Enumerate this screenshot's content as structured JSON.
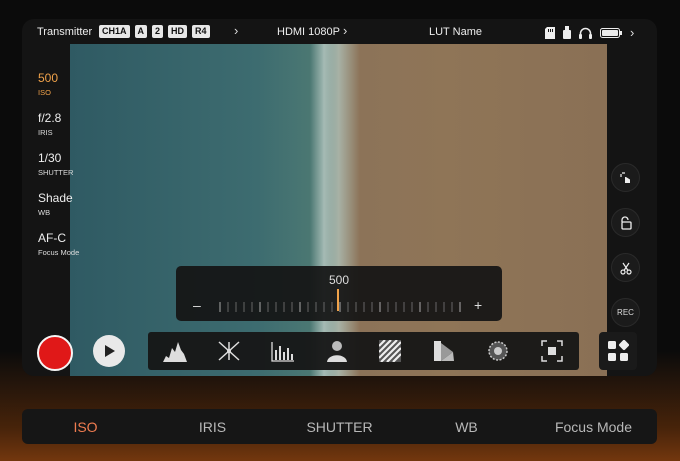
{
  "accent_color": "#f0a24a",
  "topbar": {
    "transmitter_label": "Transmitter",
    "badges": [
      "CH1A",
      "A",
      "2",
      "HD",
      "R4"
    ],
    "signal": "HDMI 1080P",
    "lut": "LUT Name"
  },
  "params": [
    {
      "value": "500",
      "label": "ISO"
    },
    {
      "value": "f/2.8",
      "label": "IRIS"
    },
    {
      "value": "1/30",
      "label": "SHUTTER"
    },
    {
      "value": "Shade",
      "label": "WB"
    },
    {
      "value": "AF-C",
      "label": "Focus Mode"
    }
  ],
  "right_buttons": {
    "rec_label": "REC"
  },
  "slider": {
    "value": "500",
    "minus": "–",
    "plus": "+"
  },
  "tabs": [
    "ISO",
    "IRIS",
    "SHUTTER",
    "WB",
    "Focus Mode"
  ],
  "icons": {
    "toolbar": [
      "histogram-icon",
      "waveform-icon",
      "vectorscope-icon",
      "false-color-icon",
      "zebra-icon",
      "peaking-icon",
      "lut-icon",
      "grid-icon",
      "fullscreen-icon"
    ],
    "status": [
      "sd-card-icon",
      "usb-icon",
      "headphones-icon",
      "battery-icon"
    ]
  }
}
